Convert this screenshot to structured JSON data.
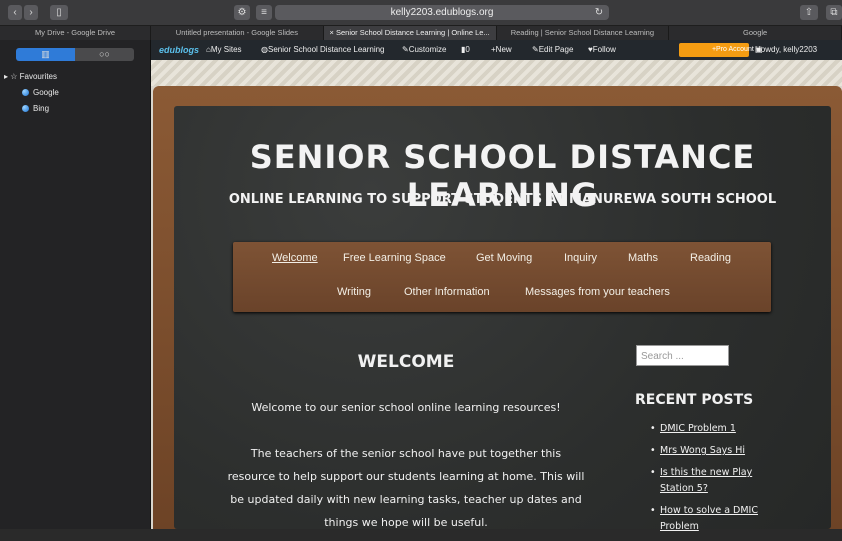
{
  "browser": {
    "url": "kelly2203.edublogs.org",
    "tabs": [
      "My Drive - Google Drive",
      "Untitled presentation - Google Slides",
      "Senior School Distance Learning | Online Le...",
      "Reading | Senior School Distance Learning",
      "Google"
    ],
    "active_tab": 2
  },
  "sidebar": {
    "segment_left_icon": "book-icon",
    "segment_right_icon": "glasses-icon",
    "favourites_label": "Favourites",
    "items": [
      "Google",
      "Bing"
    ]
  },
  "admin_bar": {
    "logo": "edublogs",
    "my_sites": "My Sites",
    "site_name": "Senior School Distance Learning",
    "customize": "Customize",
    "comments_count": "0",
    "new": "New",
    "edit_page": "Edit Page",
    "follow": "Follow",
    "pro_account": "Pro Account",
    "greeting": "Howdy, kelly2203"
  },
  "site": {
    "title": "SENIOR SCHOOL DISTANCE LEARNING",
    "subtitle": "ONLINE LEARNING TO SUPPORT STUDENTS AT MANUREWA SOUTH SCHOOL",
    "nav": [
      "Welcome",
      "Free Learning Space",
      "Get Moving",
      "Inquiry",
      "Maths",
      "Reading",
      "Writing",
      "Other Information",
      "Messages from your teachers"
    ]
  },
  "content": {
    "heading": "WELCOME",
    "intro": "Welcome to our senior school online learning resources!",
    "para_lines": [
      "The teachers of the senior school have put together this",
      "resource to help support our students learning at home. This will",
      "be updated daily with new learning tasks, teacher up dates and",
      "things we hope will be useful."
    ]
  },
  "widgets": {
    "search_placeholder": "Search ...",
    "recent_heading": "RECENT POSTS",
    "posts": [
      "DMIC Problem 1",
      "Mrs Wong Says Hi",
      "Is this the new Play Station 5?",
      "How to solve a DMIC Problem"
    ]
  }
}
